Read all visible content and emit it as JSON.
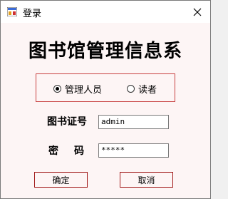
{
  "window": {
    "title": "登录"
  },
  "heading": "图书馆管理信息系",
  "role_group": {
    "options": [
      {
        "label": "管理人员",
        "selected": true
      },
      {
        "label": "读者",
        "selected": false
      }
    ]
  },
  "form": {
    "card_label": "图书证号",
    "card_value": "admin",
    "password_label": "密码",
    "password_value": "*****"
  },
  "buttons": {
    "ok": "确定",
    "cancel": "取消"
  },
  "colors": {
    "accent_border": "#c84040",
    "window_bg": "#fdf5f5"
  }
}
